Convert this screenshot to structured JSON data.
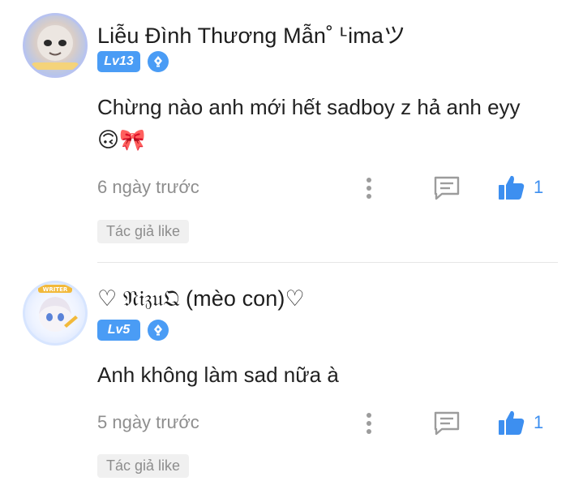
{
  "comments": [
    {
      "author": "Liễu Đình Thương Mẫn˚ ᒻimaツ",
      "level": "Lv13",
      "text": "Chừng nào anh mới hết sadboy z hả anh eyy",
      "emoji": "🙃🎀",
      "time": "6 ngày trước",
      "likes": "1",
      "tag": "Tác giả like",
      "avatar_label": "avatar"
    },
    {
      "author": "♡ 𝔑𝔦𝔷𝔲𝔔 (mèo con)♡",
      "level": "Lv5",
      "text": "Anh không làm sad nữa à",
      "emoji": "",
      "time": "5 ngày trước",
      "likes": "1",
      "tag": "Tác giả like",
      "avatar_label": "WRITER"
    }
  ],
  "colors": {
    "accent": "#4a9cf5",
    "like_count": "#3d8ff0",
    "muted": "#8e8e8e",
    "tag_bg": "#f0f0f0"
  },
  "icons": [
    "pen-badge-icon",
    "more-vertical-icon",
    "reply-icon",
    "thumbs-up-icon"
  ]
}
